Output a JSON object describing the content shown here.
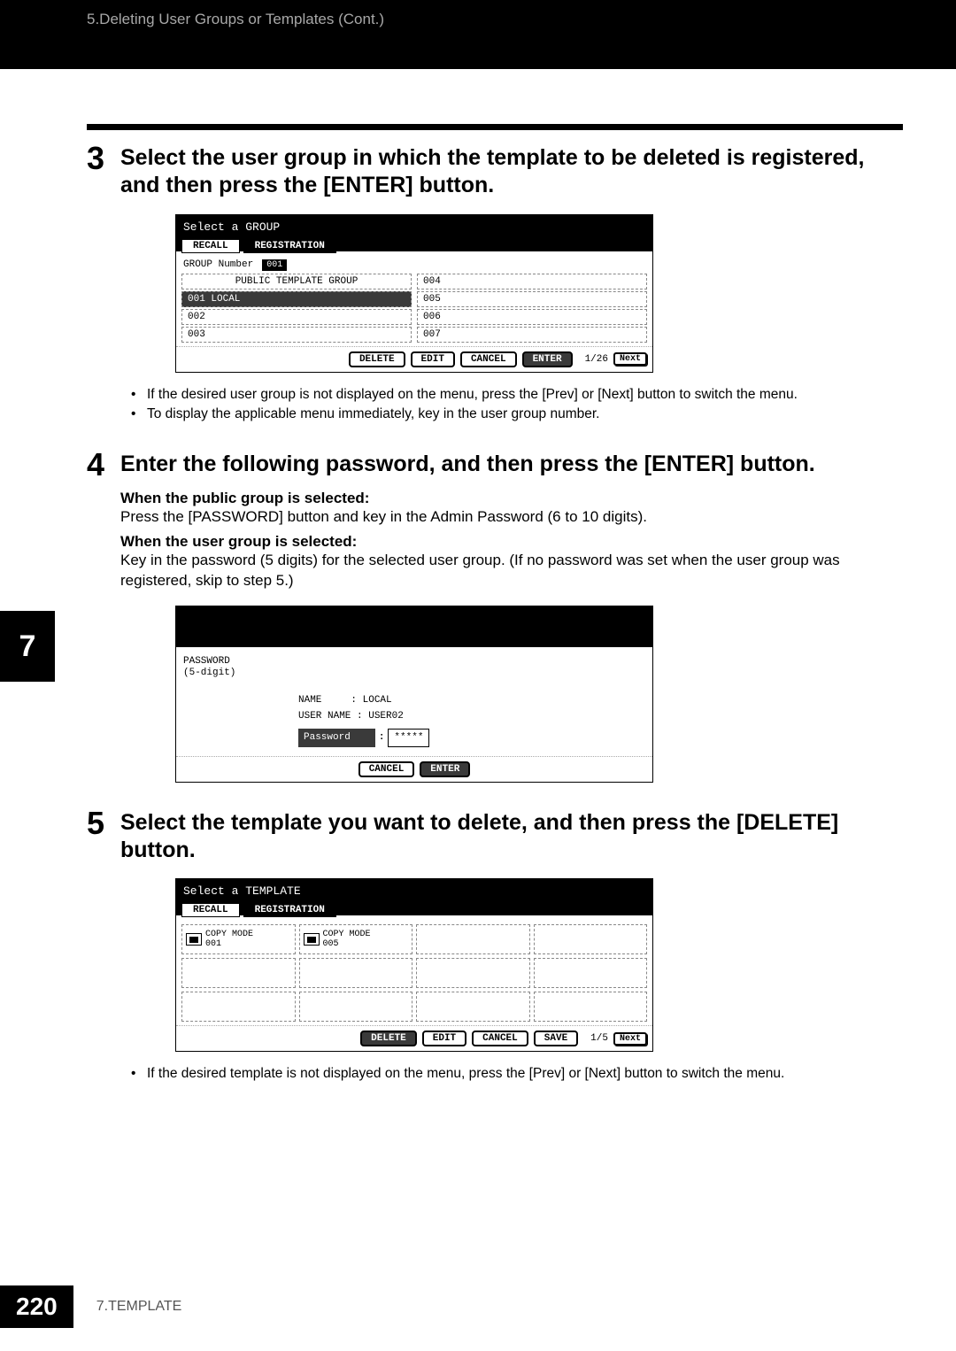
{
  "header": {
    "breadcrumb": "5.Deleting User Groups or Templates (Cont.)"
  },
  "sideTab": "7",
  "step3": {
    "num": "3",
    "heading": "Select the user group in which the template to be deleted is registered, and then press the [ENTER] button.",
    "bullets": [
      "If the desired user group is not displayed on the menu, press the [Prev] or [Next] button to switch the menu.",
      "To display the applicable menu immediately, key in the user group number."
    ]
  },
  "screen1": {
    "title": "Select a GROUP",
    "tabRecall": "RECALL",
    "tabRegistration": "REGISTRATION",
    "groupLabel": "GROUP Number",
    "groupVal": "001",
    "rows": [
      {
        "l": "PUBLIC TEMPLATE GROUP",
        "r": "004"
      },
      {
        "l": "001 LOCAL",
        "r": "005",
        "sel": true
      },
      {
        "l": "002",
        "r": "006"
      },
      {
        "l": "003",
        "r": "007"
      }
    ],
    "btnDelete": "DELETE",
    "btnEdit": "EDIT",
    "btnCancel": "CANCEL",
    "btnEnter": "ENTER",
    "page": "1/26",
    "next": "Next"
  },
  "step4": {
    "num": "4",
    "heading": "Enter the following password, and then press the [ENTER] button.",
    "sub1Bold": "When the public group is selected:",
    "sub1Text": "Press the [PASSWORD] button and key in the Admin Password (6 to 10 digits).",
    "sub2Bold": "When the user group is selected:",
    "sub2Text": "Key in the password (5 digits) for the selected user group. (If no password was set when the user group was registered, skip to step 5.)"
  },
  "screen2": {
    "pwLabel1": "PASSWORD",
    "pwLabel2": "(5-digit)",
    "nameLabel": "NAME",
    "nameVal": ": LOCAL",
    "userLabel": "USER NAME",
    "userVal": ": USER02",
    "pwField": "Password",
    "colon": ":",
    "mask": "*****",
    "btnCancel": "CANCEL",
    "btnEnter": "ENTER"
  },
  "step5": {
    "num": "5",
    "heading": "Select the template you want to delete, and then press the [DELETE] button.",
    "bullets": [
      "If the desired template is not displayed on the menu, press the [Prev] or [Next] button to switch the menu."
    ]
  },
  "screen3": {
    "title": "Select a TEMPLATE",
    "tabRecall": "RECALL",
    "tabRegistration": "REGISTRATION",
    "tmpl1": "COPY MODE\n001",
    "tmpl2": "COPY MODE\n005",
    "btnDelete": "DELETE",
    "btnEdit": "EDIT",
    "btnCancel": "CANCEL",
    "btnSave": "SAVE",
    "page": "1/5",
    "next": "Next"
  },
  "footer": {
    "pageNum": "220",
    "section": "7.TEMPLATE"
  }
}
